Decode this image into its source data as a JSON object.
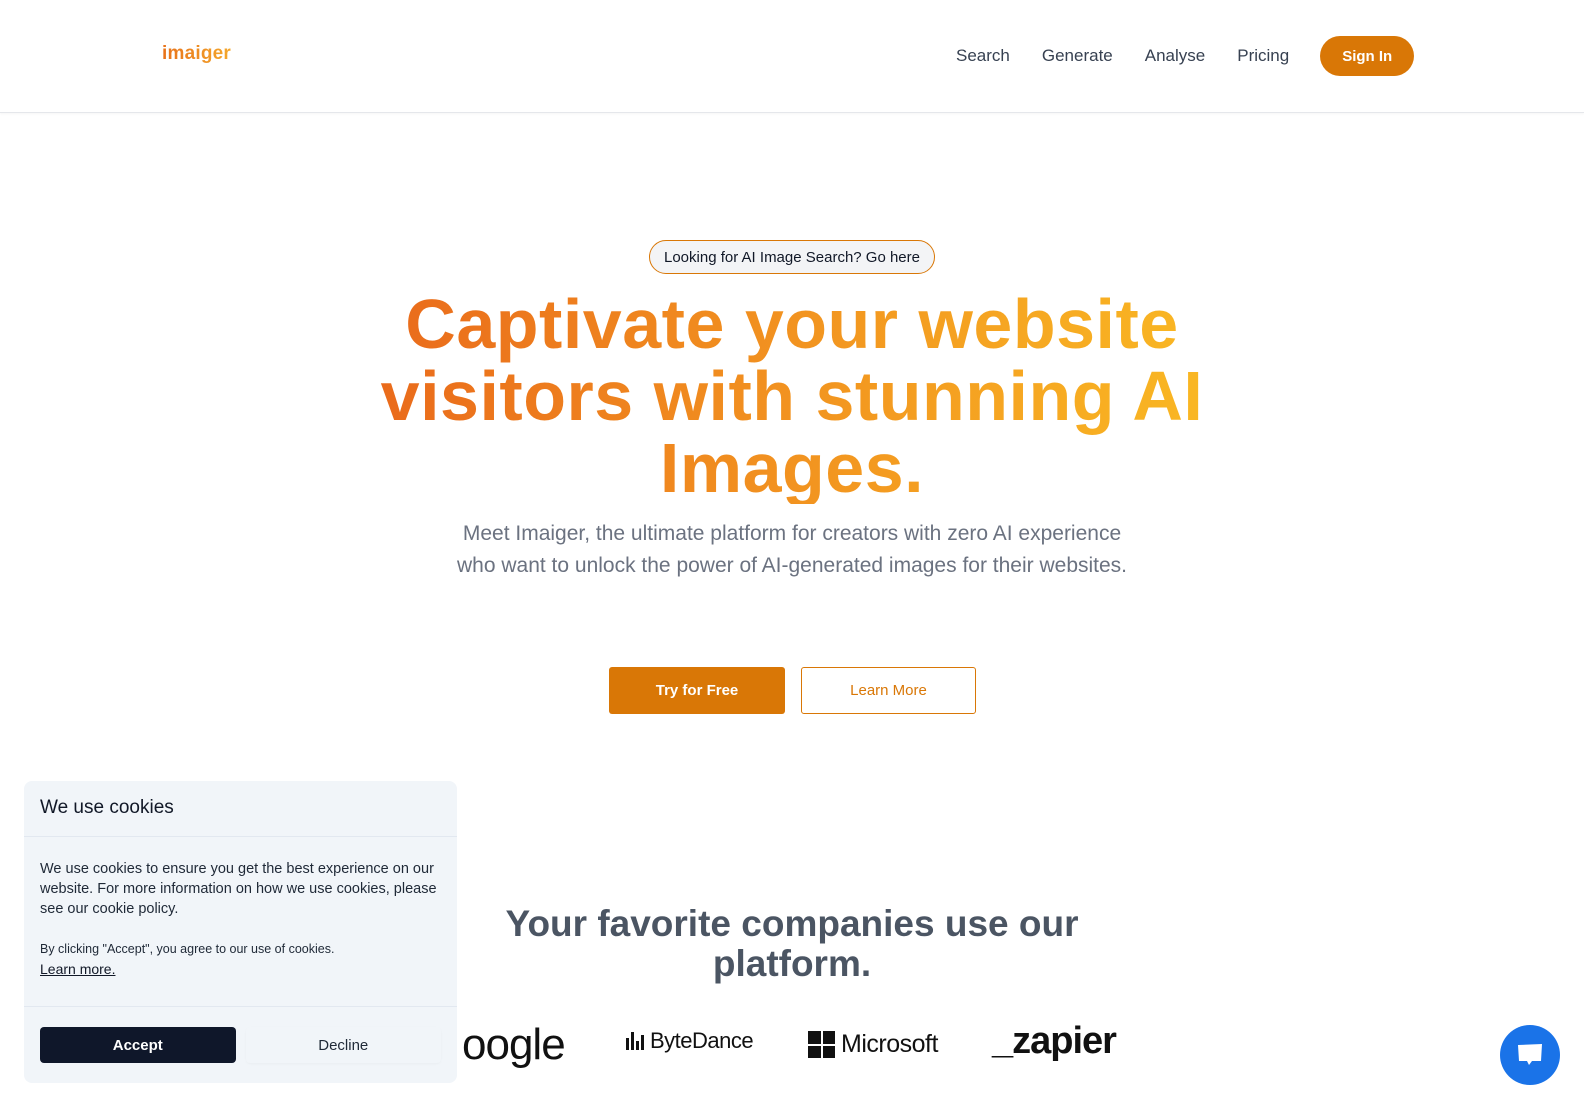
{
  "header": {
    "logo": "imaiger",
    "nav": [
      {
        "label": "Search"
      },
      {
        "label": "Generate"
      },
      {
        "label": "Analyse"
      },
      {
        "label": "Pricing"
      }
    ],
    "signin_label": "Sign In"
  },
  "hero": {
    "pill": "Looking for AI Image Search? Go here",
    "title": "Captivate your website visitors with stunning AI Images.",
    "subtitle": "Meet Imaiger, the ultimate platform for creators with zero AI experience who want to unlock the power of AI-generated images for their websites.",
    "primary_cta": "Try for Free",
    "secondary_cta": "Learn More"
  },
  "companies": {
    "title": "Your favorite companies use our platform.",
    "logos": [
      {
        "name": "Google",
        "text": "oogle"
      },
      {
        "name": "ByteDance",
        "text": "ByteDance"
      },
      {
        "name": "Microsoft",
        "text": "Microsoft"
      },
      {
        "name": "Zapier",
        "text": "_zapier"
      }
    ]
  },
  "cookie": {
    "title": "We use cookies",
    "body": "We use cookies to ensure you get the best experience on our website. For more information on how we use cookies, please see our cookie policy.",
    "note": "By clicking \"Accept\", you agree to our use of cookies.",
    "link": "Learn more.",
    "accept": "Accept",
    "decline": "Decline"
  },
  "chat": {
    "icon": "chat-bubble-icon"
  },
  "colors": {
    "accent": "#d97706",
    "gradient_start": "#e8621a",
    "gradient_end": "#fbbf24",
    "cookie_accept": "#0f172a",
    "chat": "#1a73e8"
  }
}
